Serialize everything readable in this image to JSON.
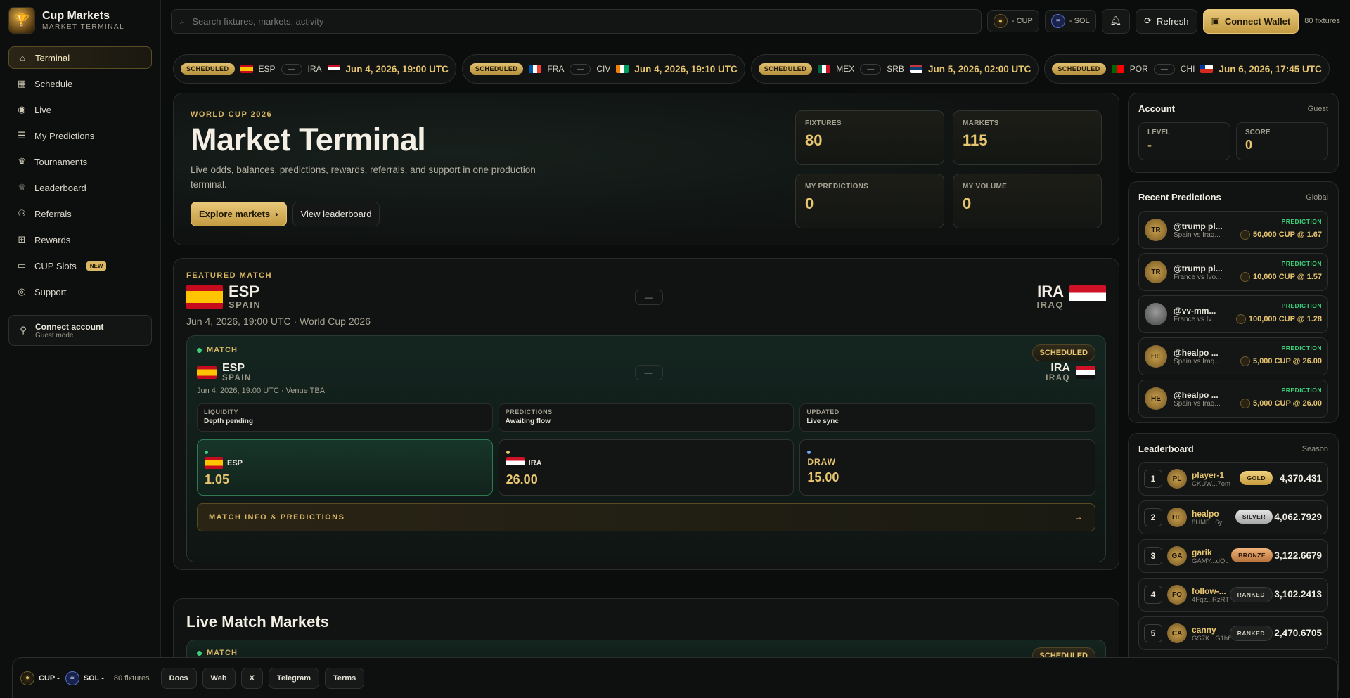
{
  "brand": {
    "title": "Cup Markets",
    "subtitle": "MARKET TERMINAL"
  },
  "sidebar": {
    "items": [
      {
        "label": "Terminal",
        "icon": "home-icon",
        "active": true
      },
      {
        "label": "Schedule",
        "icon": "calendar-icon"
      },
      {
        "label": "Live",
        "icon": "broadcast-icon"
      },
      {
        "label": "My Predictions",
        "icon": "document-icon"
      },
      {
        "label": "Tournaments",
        "icon": "crown-icon"
      },
      {
        "label": "Leaderboard",
        "icon": "trophy-icon"
      },
      {
        "label": "Referrals",
        "icon": "users-icon"
      },
      {
        "label": "Rewards",
        "icon": "gift-icon"
      },
      {
        "label": "CUP Slots",
        "icon": "slots-icon",
        "badge": "NEW"
      },
      {
        "label": "Support",
        "icon": "support-icon"
      }
    ],
    "connect": {
      "title": "Connect account",
      "subtitle": "Guest mode"
    }
  },
  "topbar": {
    "search_placeholder": "Search fixtures, markets, activity",
    "cup_balance": "- CUP",
    "sol_balance": "- SOL",
    "refresh_label": "Refresh",
    "connect_wallet_label": "Connect Wallet",
    "fixtures_count": "80 fixtures"
  },
  "ticker": [
    {
      "status": "SCHEDULED",
      "home": "ESP",
      "away": "IRA",
      "vs": "—",
      "date": "Jun 4, 2026, 19:00 UTC",
      "home_flag": "f-esp",
      "away_flag": "f-ira"
    },
    {
      "status": "SCHEDULED",
      "home": "FRA",
      "away": "CIV",
      "vs": "—",
      "date": "Jun 4, 2026, 19:10 UTC",
      "home_flag": "f-fra",
      "away_flag": "f-civ"
    },
    {
      "status": "SCHEDULED",
      "home": "MEX",
      "away": "SRB",
      "vs": "—",
      "date": "Jun 5, 2026, 02:00 UTC",
      "home_flag": "f-mex",
      "away_flag": "f-srb"
    },
    {
      "status": "SCHEDULED",
      "home": "POR",
      "away": "CHI",
      "vs": "—",
      "date": "Jun 6, 2026, 17:45 UTC",
      "home_flag": "f-por",
      "away_flag": "f-chi"
    }
  ],
  "hero": {
    "eyebrow": "WORLD CUP 2026",
    "title": "Market Terminal",
    "description": "Live odds, balances, predictions, rewards, referrals, and support in one production terminal.",
    "primary_button": "Explore markets",
    "secondary_button": "View leaderboard",
    "stats": [
      {
        "label": "FIXTURES",
        "value": "80"
      },
      {
        "label": "MARKETS",
        "value": "115"
      },
      {
        "label": "MY PREDICTIONS",
        "value": "0"
      },
      {
        "label": "MY VOLUME",
        "value": "0"
      }
    ]
  },
  "featured": {
    "eyebrow": "FEATURED MATCH",
    "home_code": "ESP",
    "home_name": "SPAIN",
    "away_code": "IRA",
    "away_name": "IRAQ",
    "vs": "—",
    "meta": "Jun 4, 2026, 19:00 UTC · World Cup 2026",
    "card": {
      "tag": "MATCH",
      "status": "SCHEDULED",
      "home_code": "ESP",
      "home_name": "SPAIN",
      "away_code": "IRA",
      "away_name": "IRAQ",
      "vs": "—",
      "meta": "Jun 4, 2026, 19:00 UTC · Venue TBA",
      "info": [
        {
          "key": "LIQUIDITY",
          "value": "Depth pending"
        },
        {
          "key": "PREDICTIONS",
          "value": "Awaiting flow"
        },
        {
          "key": "UPDATED",
          "value": "Live sync"
        }
      ],
      "odds": [
        {
          "name": "ESP",
          "price": "1.05"
        },
        {
          "name": "IRA",
          "price": "26.00"
        },
        {
          "name": "DRAW",
          "price": "15.00"
        }
      ],
      "info_button": "MATCH INFO & PREDICTIONS",
      "arrow": "→"
    }
  },
  "live": {
    "title": "Live Match Markets",
    "tag": "MATCH",
    "status": "SCHEDULED"
  },
  "account": {
    "title": "Account",
    "mode": "Guest",
    "level_label": "LEVEL",
    "level_value": "-",
    "score_label": "SCORE",
    "score_value": "0"
  },
  "recent": {
    "title": "Recent Predictions",
    "scope": "Global",
    "items": [
      {
        "initials": "TR",
        "user": "@trump pl...",
        "match": "Spain vs Iraq...",
        "tag": "PREDICTION",
        "amount": "50,000 CUP @ 1.67"
      },
      {
        "initials": "TR",
        "user": "@trump pl...",
        "match": "France vs Ivo...",
        "tag": "PREDICTION",
        "amount": "10,000 CUP @ 1.57"
      },
      {
        "initials": "",
        "user": "@vv-mm...",
        "match": "France vs Iv...",
        "tag": "PREDICTION",
        "amount": "100,000 CUP @ 1.28"
      },
      {
        "initials": "HE",
        "user": "@healpo ...",
        "match": "Spain vs Iraq...",
        "tag": "PREDICTION",
        "amount": "5,000 CUP @ 26.00"
      },
      {
        "initials": "HE",
        "user": "@healpo ...",
        "match": "Spain vs Iraq...",
        "tag": "PREDICTION",
        "amount": "5,000 CUP @ 26.00"
      }
    ]
  },
  "leaderboard": {
    "title": "Leaderboard",
    "scope": "Season",
    "items": [
      {
        "rank": "1",
        "initials": "PL",
        "name": "player-1",
        "addr": "CKUW...7om",
        "tier": "GOLD",
        "tier_class": "gold",
        "score": "4,370.431"
      },
      {
        "rank": "2",
        "initials": "HE",
        "name": "healpo",
        "addr": "8HM5...6y",
        "tier": "SILVER",
        "tier_class": "silver",
        "score": "4,062.7929"
      },
      {
        "rank": "3",
        "initials": "GA",
        "name": "garik",
        "addr": "GAMY...dQu",
        "tier": "BRONZE",
        "tier_class": "bronze",
        "score": "3,122.6679"
      },
      {
        "rank": "4",
        "initials": "FO",
        "name": "follow-...",
        "addr": "4Fqz...RzRT",
        "tier": "RANKED",
        "tier_class": "ranked",
        "score": "3,102.2413"
      },
      {
        "rank": "5",
        "initials": "CA",
        "name": "canny",
        "addr": "GS7K...G1hf",
        "tier": "RANKED",
        "tier_class": "ranked",
        "score": "2,470.6705"
      }
    ]
  },
  "footer": {
    "cup": "CUP -",
    "sol": "SOL -",
    "fixtures": "80 fixtures",
    "links": [
      "Docs",
      "Web",
      "X",
      "Telegram",
      "Terms"
    ]
  },
  "colors": {
    "accent": "#d9b764",
    "background": "#0b0d0d",
    "positive": "#3ccf7a"
  }
}
